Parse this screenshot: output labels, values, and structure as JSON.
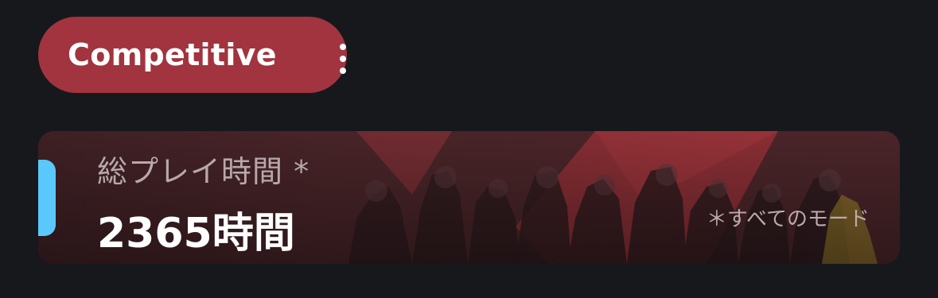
{
  "mode": {
    "label": "Competitive",
    "menu_icon": "kebab-menu-icon",
    "color": "#a1343e"
  },
  "stat_card": {
    "title": "総プレイ時間 *",
    "value": "2365時間",
    "note": "＊すべてのモード",
    "accent_color": "#5ac8fa",
    "background_art": "agents-group-artwork"
  }
}
